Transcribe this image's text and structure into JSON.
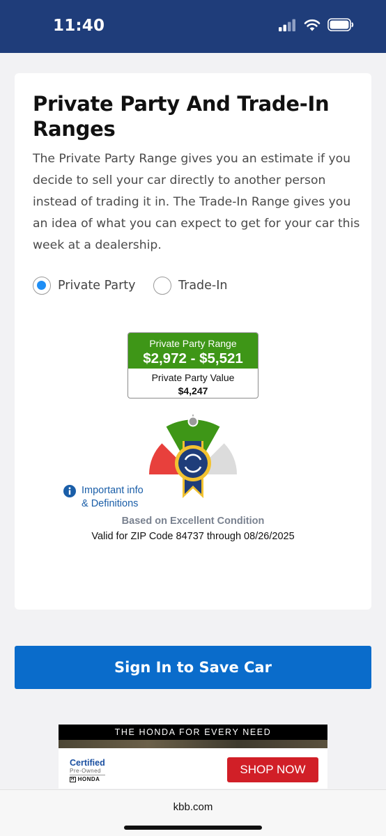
{
  "status_bar": {
    "time": "11:40"
  },
  "card": {
    "title": "Private Party And Trade-In Ranges",
    "description": "The Private Party Range gives you an estimate if you decide to sell your car directly to another person instead of trading it in. The Trade-In Range gives you an idea of what you can expect to get for your car this week at a dealership.",
    "options": [
      {
        "label": "Private Party",
        "selected": true
      },
      {
        "label": "Trade-In",
        "selected": false
      }
    ],
    "range": {
      "label": "Private Party Range",
      "value": "$2,972 - $5,521",
      "pp_label": "Private Party Value",
      "pp_value": "$4,247"
    },
    "info_link": {
      "line1": "Important info",
      "line2": "& Definitions"
    },
    "condition": "Based on Excellent Condition",
    "zip_note": "Valid for ZIP Code 84737 through 08/26/2025"
  },
  "sign_in_button": "Sign In to Save Car",
  "ad": {
    "header": "THE HONDA FOR EVERY NEED",
    "certified_title": "Certified",
    "certified_sub": "Pre-Owned",
    "certified_brand": "HONDA",
    "shop_button": "SHOP NOW"
  },
  "browser": {
    "url": "kbb.com"
  },
  "colors": {
    "header": "#1f3d7a",
    "range_green": "#3e9617",
    "gauge_red": "#e8403c",
    "gauge_grey": "#dcdcdc",
    "radio_blue": "#1e8ef5",
    "button_blue": "#0a6ccb",
    "ad_red": "#d11f27"
  }
}
